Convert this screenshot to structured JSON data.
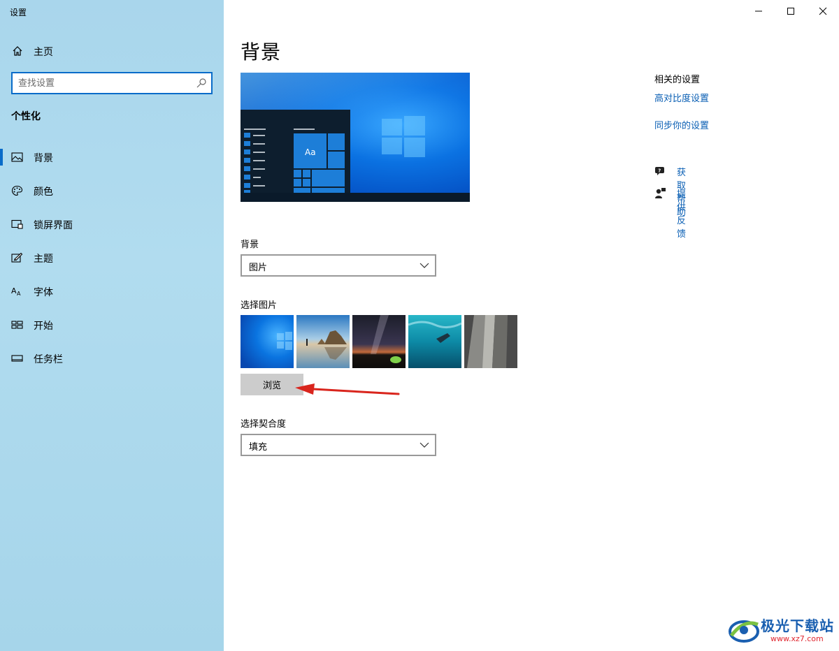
{
  "app": {
    "title": "设置"
  },
  "window_controls": {
    "minimize": "minimize-icon",
    "maximize": "maximize-icon",
    "close": "close-icon"
  },
  "sidebar": {
    "home_label": "主页",
    "search": {
      "placeholder": "查找设置",
      "value": ""
    },
    "section_title": "个性化",
    "items": [
      {
        "label": "背景",
        "icon": "picture-icon",
        "active": true
      },
      {
        "label": "颜色",
        "icon": "palette-icon",
        "active": false
      },
      {
        "label": "锁屏界面",
        "icon": "lock-screen-icon",
        "active": false
      },
      {
        "label": "主题",
        "icon": "theme-icon",
        "active": false
      },
      {
        "label": "字体",
        "icon": "font-icon",
        "active": false
      },
      {
        "label": "开始",
        "icon": "start-icon",
        "active": false
      },
      {
        "label": "任务栏",
        "icon": "taskbar-icon",
        "active": false
      }
    ]
  },
  "main": {
    "title": "背景",
    "preview_tile_text": "Aa",
    "background_label": "背景",
    "background_value": "图片",
    "choose_picture_label": "选择图片",
    "browse_label": "浏览",
    "fit_label": "选择契合度",
    "fit_value": "填充"
  },
  "related": {
    "title": "相关的设置",
    "links": [
      "高对比度设置",
      "同步你的设置"
    ],
    "help": {
      "get_help": "获取帮助",
      "feedback": "提供反馈"
    }
  },
  "watermark": {
    "brand": "极光下载站",
    "url": "www.xz7.com"
  },
  "colors": {
    "accent": "#0a6cc9",
    "link": "#0a5fb4",
    "sidebar": "#a9d6ec",
    "arrow": "#d9251d"
  }
}
